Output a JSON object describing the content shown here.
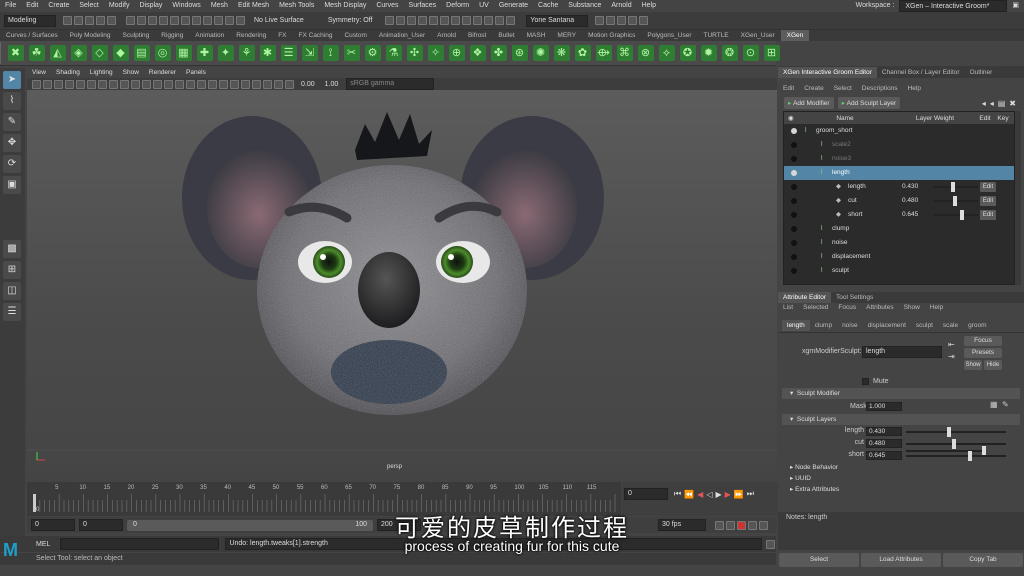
{
  "menubar": {
    "items": [
      "File",
      "Edit",
      "Create",
      "Select",
      "Modify",
      "Display",
      "Windows",
      "Mesh",
      "Edit Mesh",
      "Mesh Tools",
      "Mesh Display",
      "Curves",
      "Surfaces",
      "Deform",
      "UV",
      "Generate",
      "Cache",
      "Substance",
      "Arnold",
      "Help"
    ],
    "workspace_label": "Workspace :",
    "workspace_value": "XGen – Interactive Groom*"
  },
  "status": {
    "mode": "Modeling",
    "live_surface": "No Live Surface",
    "symmetry": "Symmetry: Off",
    "user": "Yone Santana"
  },
  "shelf": {
    "tabs": [
      "Curves / Surfaces",
      "Poly Modeling",
      "Sculpting",
      "Rigging",
      "Animation",
      "Rendering",
      "FX",
      "FX Caching",
      "Custom",
      "Animation_User",
      "Arnold",
      "Bifrost",
      "Bullet",
      "MASH",
      "MERY",
      "Motion Graphics",
      "Polygons_User",
      "TURTLE",
      "XGen_User",
      "XGen"
    ],
    "active": "XGen"
  },
  "viewport": {
    "menus": [
      "View",
      "Shading",
      "Lighting",
      "Show",
      "Renderer",
      "Panels"
    ],
    "exposure": "0.00",
    "gamma": "1.00",
    "colorspace": "sRGB gamma",
    "camera": "persp"
  },
  "timeline": {
    "ticks": [
      "5",
      "10",
      "15",
      "20",
      "25",
      "30",
      "35",
      "40",
      "45",
      "50",
      "55",
      "60",
      "65",
      "70",
      "75",
      "80",
      "85",
      "90",
      "95",
      "100",
      "105",
      "110",
      "115"
    ],
    "current_frame": "0",
    "start": "0",
    "playback_start": "0",
    "anim_start": "0",
    "anim_end": "100",
    "end": "200",
    "fps": "30 fps"
  },
  "command": {
    "lang": "MEL",
    "result": "Undo: length.tweaks[1].strength",
    "help": "Select Tool: select an object"
  },
  "subtitle": {
    "zh": "可爱的皮草制作过程",
    "en": "process of creating fur for this cute"
  },
  "groom_editor": {
    "tabs": [
      "XGen Interactive Groom Editor",
      "Channel Box / Layer Editor",
      "Outliner"
    ],
    "menus": [
      "Edit",
      "Create",
      "Select",
      "Descriptions",
      "Help"
    ],
    "add_modifier": "Add Modifier",
    "add_sculpt_layer": "Add Sculpt Layer",
    "columns": {
      "name": "Name",
      "weight": "Layer Weight",
      "edit": "Edit",
      "key": "Key"
    },
    "rows": [
      {
        "name": "groom_short",
        "indent": 0,
        "vis": true,
        "dim": false,
        "hl": false
      },
      {
        "name": "scale2",
        "indent": 1,
        "vis": false,
        "dim": true,
        "hl": false
      },
      {
        "name": "noise3",
        "indent": 1,
        "vis": false,
        "dim": true,
        "hl": false
      },
      {
        "name": "length",
        "indent": 1,
        "vis": true,
        "dim": false,
        "hl": true
      },
      {
        "name": "length",
        "indent": 2,
        "vis": false,
        "dim": false,
        "hl": false,
        "weight": "0.430",
        "w": 0.43
      },
      {
        "name": "cut",
        "indent": 2,
        "vis": false,
        "dim": false,
        "hl": false,
        "weight": "0.480",
        "w": 0.48
      },
      {
        "name": "short",
        "indent": 2,
        "vis": false,
        "dim": false,
        "hl": false,
        "weight": "0.645",
        "w": 0.645
      },
      {
        "name": "clump",
        "indent": 1,
        "vis": false,
        "dim": false,
        "hl": false
      },
      {
        "name": "noise",
        "indent": 1,
        "vis": false,
        "dim": false,
        "hl": false
      },
      {
        "name": "displacement",
        "indent": 1,
        "vis": false,
        "dim": false,
        "hl": false
      },
      {
        "name": "sculpt",
        "indent": 1,
        "vis": false,
        "dim": false,
        "hl": false
      }
    ],
    "edit_label": "Edit"
  },
  "attribute_editor": {
    "tabs": [
      "Attribute Editor",
      "Tool Settings"
    ],
    "menus": [
      "List",
      "Selected",
      "Focus",
      "Attributes",
      "Show",
      "Help"
    ],
    "node_tabs": [
      "length",
      "clump",
      "noise",
      "displacement",
      "sculpt",
      "scale",
      "groom"
    ],
    "node_label": "xgmModifierSculpt:",
    "node_value": "length",
    "focus": "Focus",
    "presets": "Presets",
    "show": "Show",
    "hide": "Hide",
    "mute": "Mute",
    "sculpt_modifier": "Sculpt Modifier",
    "mask_label": "Mask",
    "mask_value": "1.000",
    "sculpt_layers": "Sculpt Layers",
    "layers": [
      {
        "label": "length",
        "value": "0.430",
        "w": 0.43
      },
      {
        "label": "cut",
        "value": "0.480",
        "w": 0.48
      },
      {
        "label": "short",
        "value": "0.645",
        "w": 0.645
      }
    ],
    "collapsed": [
      "Node Behavior",
      "UUID",
      "Extra Attributes"
    ],
    "notes": "Notes:  length",
    "select": "Select",
    "load": "Load Attributes",
    "copy": "Copy Tab"
  }
}
